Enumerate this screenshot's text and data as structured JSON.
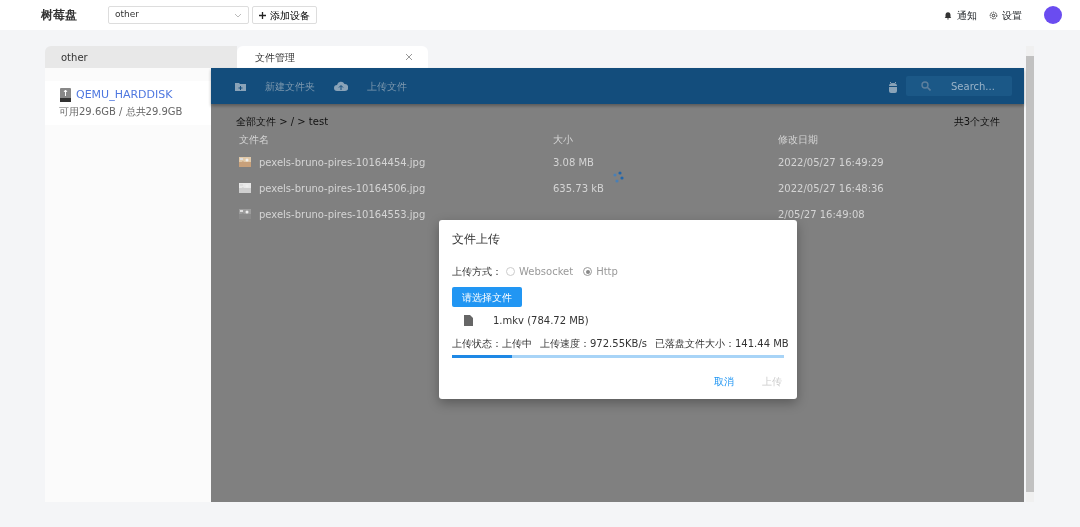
{
  "app": {
    "title": "树莓盘"
  },
  "device_select": {
    "value": "other"
  },
  "add_device_button": "添加设备",
  "header_links": [
    {
      "kind": "notify",
      "label": "通知"
    },
    {
      "kind": "settings",
      "label": "设置"
    }
  ],
  "tabs": [
    {
      "label": "other",
      "selected": false,
      "closable": false
    },
    {
      "label": "文件管理",
      "selected": true,
      "closable": true
    }
  ],
  "disks": [
    {
      "name": "QEMU_HARDDISK",
      "usage": "可用29.6GB / 总共29.9GB"
    }
  ],
  "toolbar": {
    "actions": [
      {
        "kind": "new_folder",
        "label": "新建文件夹"
      },
      {
        "kind": "upload",
        "label": "上传文件"
      }
    ],
    "search": {
      "placeholder": "Search..."
    }
  },
  "breadcrumb": "全部文件 > / > test",
  "file_count": "共3个文件",
  "columns": [
    "文件名",
    "大小",
    "修改日期"
  ],
  "files": [
    {
      "name": "pexels-bruno-pires-10164454.jpg",
      "size": "3.08 MB",
      "modified": "2022/05/27 16:49:29"
    },
    {
      "name": "pexels-bruno-pires-10164506.jpg",
      "size": "635.73 kB",
      "modified": "2022/05/27 16:48:36"
    },
    {
      "name": "pexels-bruno-pires-10164553.jpg",
      "modified": "2/05/27 16:49:08"
    }
  ],
  "dialog": {
    "title": "文件上传",
    "method_label": "上传方式：",
    "methods": [
      {
        "label": "Websocket",
        "selected": false
      },
      {
        "label": "Http",
        "selected": true
      }
    ],
    "choose_button": "请选择文件",
    "file": "1.mkv (784.72 MB)",
    "status_items": [
      "上传状态：上传中",
      "上传速度：972.55KB/s",
      "已落盘文件大小：141.44 MB"
    ],
    "level": 0.18,
    "buttons": [
      {
        "label": "取消",
        "disabled": false
      },
      {
        "label": "上传",
        "disabled": true
      }
    ]
  }
}
